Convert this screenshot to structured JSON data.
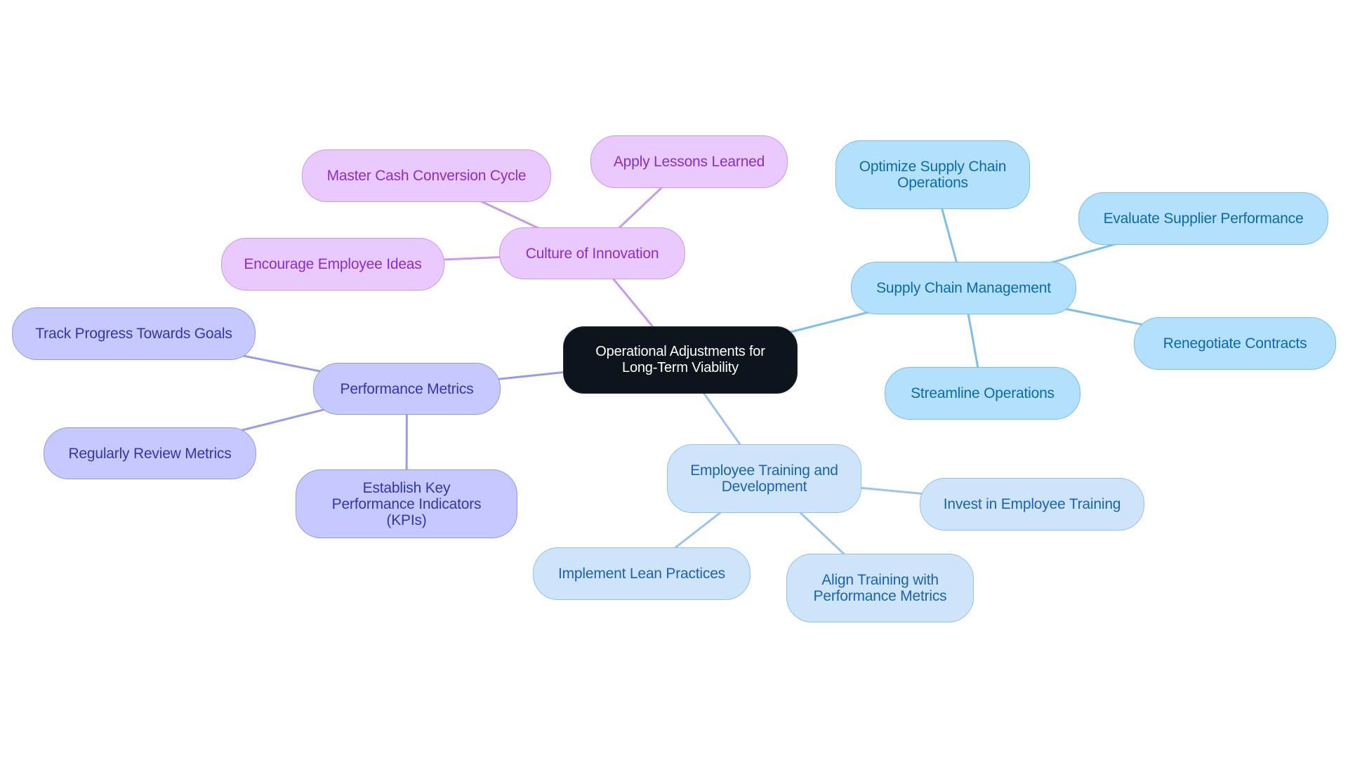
{
  "diagram": {
    "type": "mindmap",
    "root": {
      "id": "root",
      "label": "Operational Adjustments for Long-Term Viability"
    },
    "colors": {
      "root_fill": "#0d141b",
      "purple_fill": "#e9c9ff",
      "purple_text": "#8a2fc4",
      "purple_edge": "#c79be6",
      "indigo_fill": "#c6c9ff",
      "indigo_text": "#3236a8",
      "indigo_edge": "#9a9de6",
      "sky_fill": "#b3e0fd",
      "sky_text": "#0b6aa8",
      "sky_edge": "#7fbfe6",
      "pale_fill": "#cde4fb",
      "pale_text": "#1c62ae",
      "pale_edge": "#9cc4ea"
    },
    "branches": [
      {
        "id": "culture",
        "label": "Culture of Innovation",
        "theme": "purple",
        "children": [
          {
            "id": "master-cash",
            "label": "Master Cash Conversion Cycle"
          },
          {
            "id": "apply-lessons",
            "label": "Apply Lessons Learned"
          },
          {
            "id": "encourage-ideas",
            "label": "Encourage Employee Ideas"
          }
        ]
      },
      {
        "id": "supply",
        "label": "Supply Chain Management",
        "theme": "sky",
        "children": [
          {
            "id": "optimize-supply",
            "label": "Optimize Supply Chain Operations"
          },
          {
            "id": "evaluate-supplier",
            "label": "Evaluate Supplier Performance"
          },
          {
            "id": "renegotiate",
            "label": "Renegotiate Contracts"
          },
          {
            "id": "streamline",
            "label": "Streamline Operations"
          }
        ]
      },
      {
        "id": "performance",
        "label": "Performance Metrics",
        "theme": "indigo",
        "children": [
          {
            "id": "track-progress",
            "label": "Track Progress Towards Goals"
          },
          {
            "id": "review-metrics",
            "label": "Regularly Review Metrics"
          },
          {
            "id": "establish-kpis",
            "label": "Establish Key Performance Indicators (KPIs)"
          }
        ]
      },
      {
        "id": "training",
        "label": "Employee Training and Development",
        "theme": "pale",
        "children": [
          {
            "id": "invest-training",
            "label": "Invest in Employee Training"
          },
          {
            "id": "lean-practices",
            "label": "Implement Lean Practices"
          },
          {
            "id": "align-training",
            "label": "Align Training with Performance Metrics"
          }
        ]
      }
    ]
  }
}
